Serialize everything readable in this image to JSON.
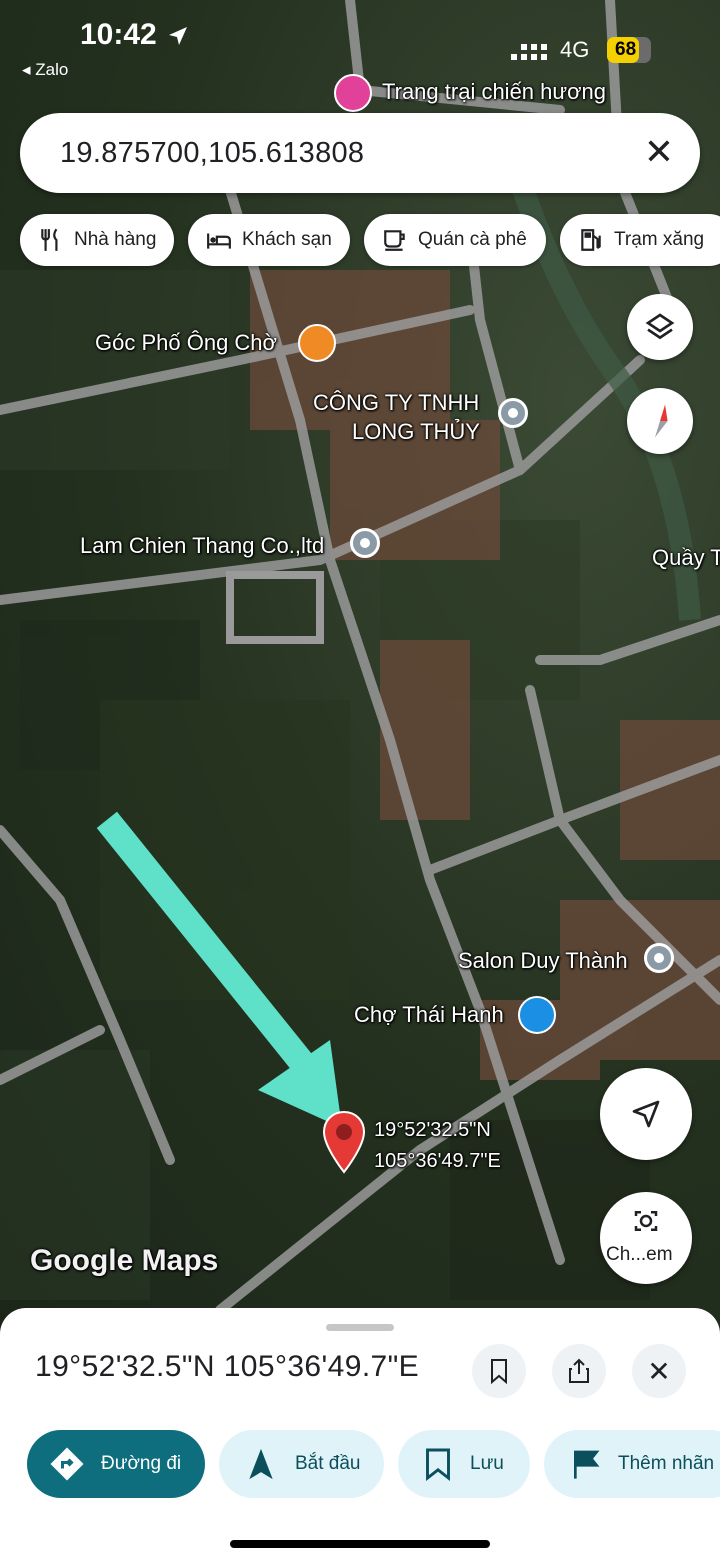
{
  "status_bar": {
    "time": "10:42",
    "back_app": "◂ Zalo",
    "network": "4G",
    "battery": "68"
  },
  "search": {
    "query": "19.875700,105.613808",
    "clear_icon": "close-icon"
  },
  "chips": [
    {
      "label": "Nhà hàng",
      "icon": "restaurant-icon"
    },
    {
      "label": "Khách sạn",
      "icon": "hotel-icon"
    },
    {
      "label": "Quán cà phê",
      "icon": "cafe-icon"
    },
    {
      "label": "Trạm xăng",
      "icon": "gas-station-icon"
    }
  ],
  "map_labels": {
    "trang_trai": "Trang trại chiến hương",
    "goc_pho": "Góc Phố Ông Chờ",
    "cong_ty_line1": "CÔNG TY TNHH",
    "cong_ty_line2": "LONG THỦY",
    "lam_chien": "Lam Chien Thang Co.,ltd",
    "quay": "Quầy T",
    "salon": "Salon Duy Thành",
    "cho": "Chợ Thái Hanh",
    "pin_lat": "19°52'32.5\"N",
    "pin_lng": "105°36'49.7\"E",
    "watermark": "Google Maps"
  },
  "fab": {
    "camera_label": "Ch...em"
  },
  "sheet": {
    "coordinates": "19°52'32.5\"N 105°36'49.7\"E",
    "actions": [
      {
        "label": "Đường đi",
        "icon": "directions-icon"
      },
      {
        "label": "Bắt đầu",
        "icon": "navigation-arrow-icon"
      },
      {
        "label": "Lưu",
        "icon": "bookmark-icon"
      },
      {
        "label": "Thêm nhãn",
        "icon": "flag-icon"
      }
    ]
  },
  "colors": {
    "accent": "#0f6e7d",
    "pin": "#e53935",
    "annotation_arrow": "#5fe0c8"
  }
}
